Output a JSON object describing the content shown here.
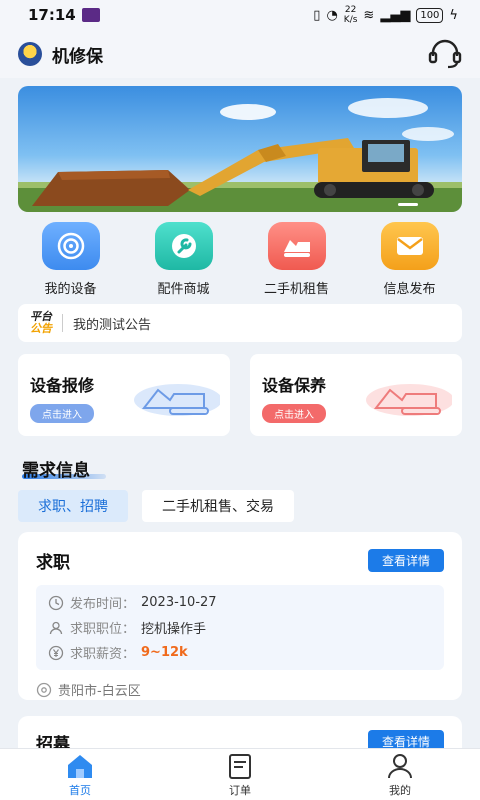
{
  "status_bar": {
    "time": "17:14",
    "net_speed_value": "22",
    "net_speed_unit": "K/s",
    "battery": "100"
  },
  "header": {
    "title": "机修保",
    "logo_text": "机修保"
  },
  "quick_menu": [
    {
      "label": "我的设备",
      "icon": "target-icon",
      "color": "#3d8bef"
    },
    {
      "label": "配件商城",
      "icon": "wrench-icon",
      "color": "#23c3b0"
    },
    {
      "label": "二手机租售",
      "icon": "excavator-icon",
      "color": "#f5655a"
    },
    {
      "label": "信息发布",
      "icon": "envelope-icon",
      "color": "#f7a51c"
    }
  ],
  "notice": {
    "tag_line1": "平台",
    "tag_line2": "公告",
    "text": "我的测试公告"
  },
  "services": [
    {
      "title": "设备报修",
      "button": "点击进入",
      "color": "#6a9de8"
    },
    {
      "title": "设备保养",
      "button": "点击进入",
      "color": "#f36a6a"
    }
  ],
  "section": {
    "title": "需求信息"
  },
  "filter_tabs": [
    {
      "label": "求职、招聘",
      "active": true
    },
    {
      "label": "二手机租售、交易",
      "active": false
    }
  ],
  "job_card": {
    "title": "求职",
    "detail_button": "查看详情",
    "rows": [
      {
        "key": "发布时间：",
        "value": "2023-10-27"
      },
      {
        "key": "求职职位：",
        "value": "挖机操作手"
      },
      {
        "key": "求职薪资：",
        "value": "9~12k"
      }
    ],
    "location": "贵阳市-白云区"
  },
  "job_card2": {
    "title": "招募",
    "detail_button": "查看详情"
  },
  "tab_bar": [
    {
      "label": "首页",
      "active": true
    },
    {
      "label": "订单",
      "active": false
    },
    {
      "label": "我的",
      "active": false
    }
  ]
}
